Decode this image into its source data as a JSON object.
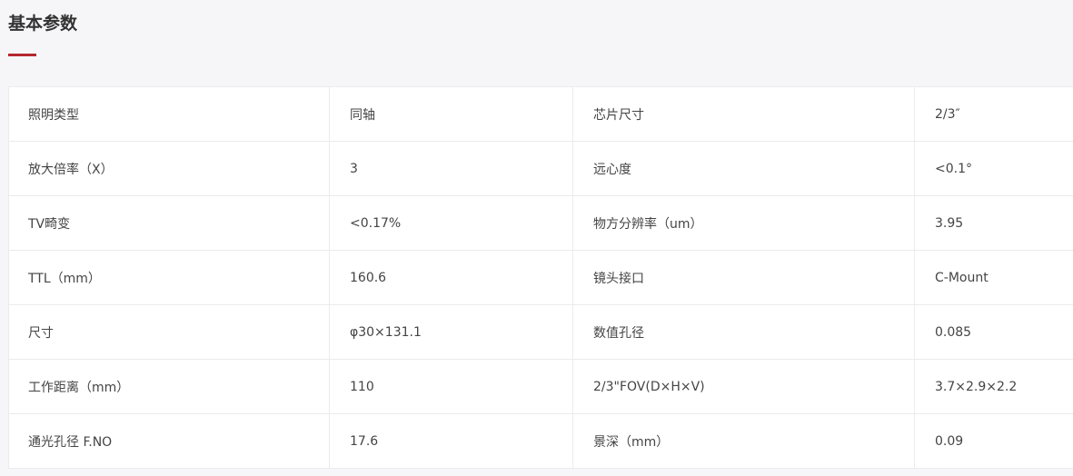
{
  "section": {
    "title": "基本参数"
  },
  "colors": {
    "accent": "#b4282d",
    "border": "#ebebeb",
    "background": "#f6f6f8"
  },
  "spec_rows": [
    {
      "label1": "照明类型",
      "value1": "同轴",
      "label2": "芯片尺寸",
      "value2": "2/3″"
    },
    {
      "label1": "放大倍率（X）",
      "value1": "3",
      "label2": "远心度",
      "value2": "<0.1°"
    },
    {
      "label1": "TV畸变",
      "value1": "<0.17%",
      "label2": "物方分辨率（um）",
      "value2": "3.95"
    },
    {
      "label1": "TTL（mm）",
      "value1": "160.6",
      "label2": "镜头接口",
      "value2": "C-Mount"
    },
    {
      "label1": "尺寸",
      "value1": "φ30×131.1",
      "label2": "数值孔径",
      "value2": "0.085"
    },
    {
      "label1": "工作距离（mm）",
      "value1": "110",
      "label2": "2/3\"FOV(D×H×V)",
      "value2": "3.7×2.9×2.2"
    },
    {
      "label1": "通光孔径 F.NO",
      "value1": "17.6",
      "label2": "景深（mm）",
      "value2": "0.09"
    }
  ]
}
